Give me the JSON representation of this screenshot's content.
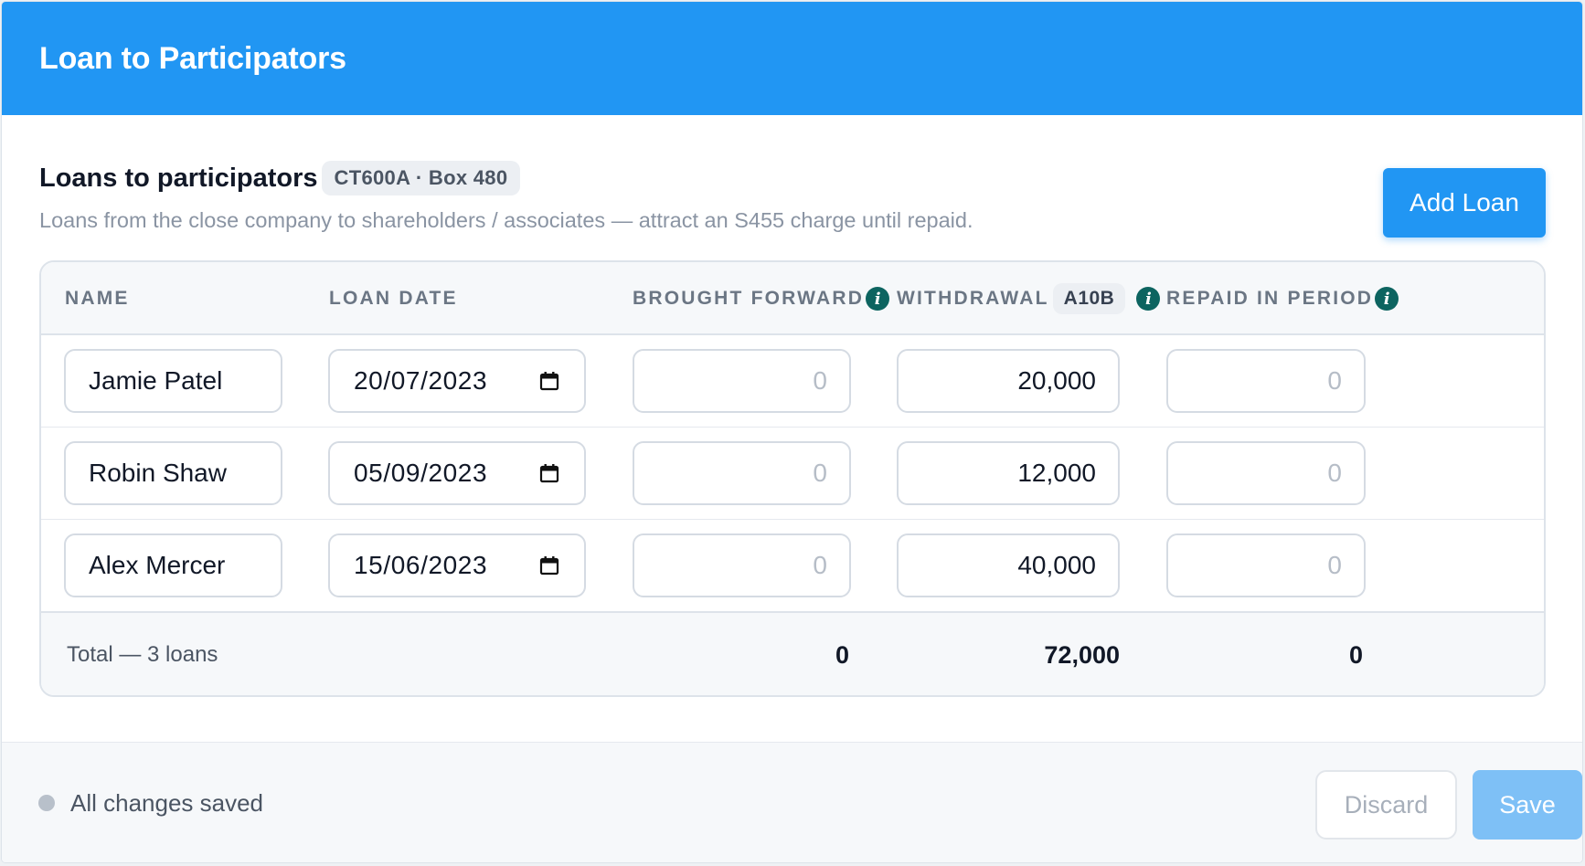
{
  "header": {
    "title": "Loan to Participators"
  },
  "section": {
    "title": "Loans to participators",
    "badge": "CT600A · Box 480",
    "subtitle": "Loans from the close company to shareholders / associates — attract an S455 charge until repaid.",
    "add_button": "Add Loan"
  },
  "table": {
    "columns": {
      "name": "NAME",
      "loan_date": "LOAN DATE",
      "brought_forward": "BROUGHT FORWARD",
      "withdrawal": "WITHDRAWAL",
      "withdrawal_tag": "A10B",
      "repaid": "REPAID IN PERIOD"
    },
    "rows": [
      {
        "name": "Jamie Patel",
        "date": "20/07/2023",
        "brought_forward": "0",
        "withdrawal": "20,000",
        "repaid": "0"
      },
      {
        "name": "Robin Shaw",
        "date": "05/09/2023",
        "brought_forward": "0",
        "withdrawal": "12,000",
        "repaid": "0"
      },
      {
        "name": "Alex Mercer",
        "date": "15/06/2023",
        "brought_forward": "0",
        "withdrawal": "40,000",
        "repaid": "0"
      }
    ],
    "totals": {
      "label": "Total — 3 loans",
      "brought_forward": "0",
      "withdrawal": "72,000",
      "repaid": "0"
    }
  },
  "footer": {
    "status": "All changes saved",
    "discard_label": "Discard",
    "save_label": "Save"
  },
  "colors": {
    "primary": "#2196f3",
    "info_icon": "#0d6460",
    "save_disabled": "#7ec0f6"
  },
  "icons": {
    "info": "info-icon",
    "calendar": "calendar-icon",
    "status": "status-dot-icon"
  }
}
